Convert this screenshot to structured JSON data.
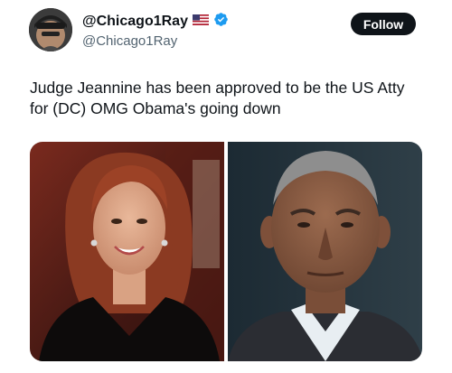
{
  "tweet": {
    "display_name": "@Chicago1Ray",
    "handle": "@Chicago1Ray",
    "follow_label": "Follow",
    "text": "Judge Jeannine has been approved to be the US Atty\nfor (DC) OMG Obama's going down",
    "flag_icon": "us-flag-icon",
    "verified_icon": "verified-badge-icon",
    "colors": {
      "verified": "#1d9bf0",
      "follow_bg": "#0f1419",
      "handle_text": "#536471"
    }
  }
}
